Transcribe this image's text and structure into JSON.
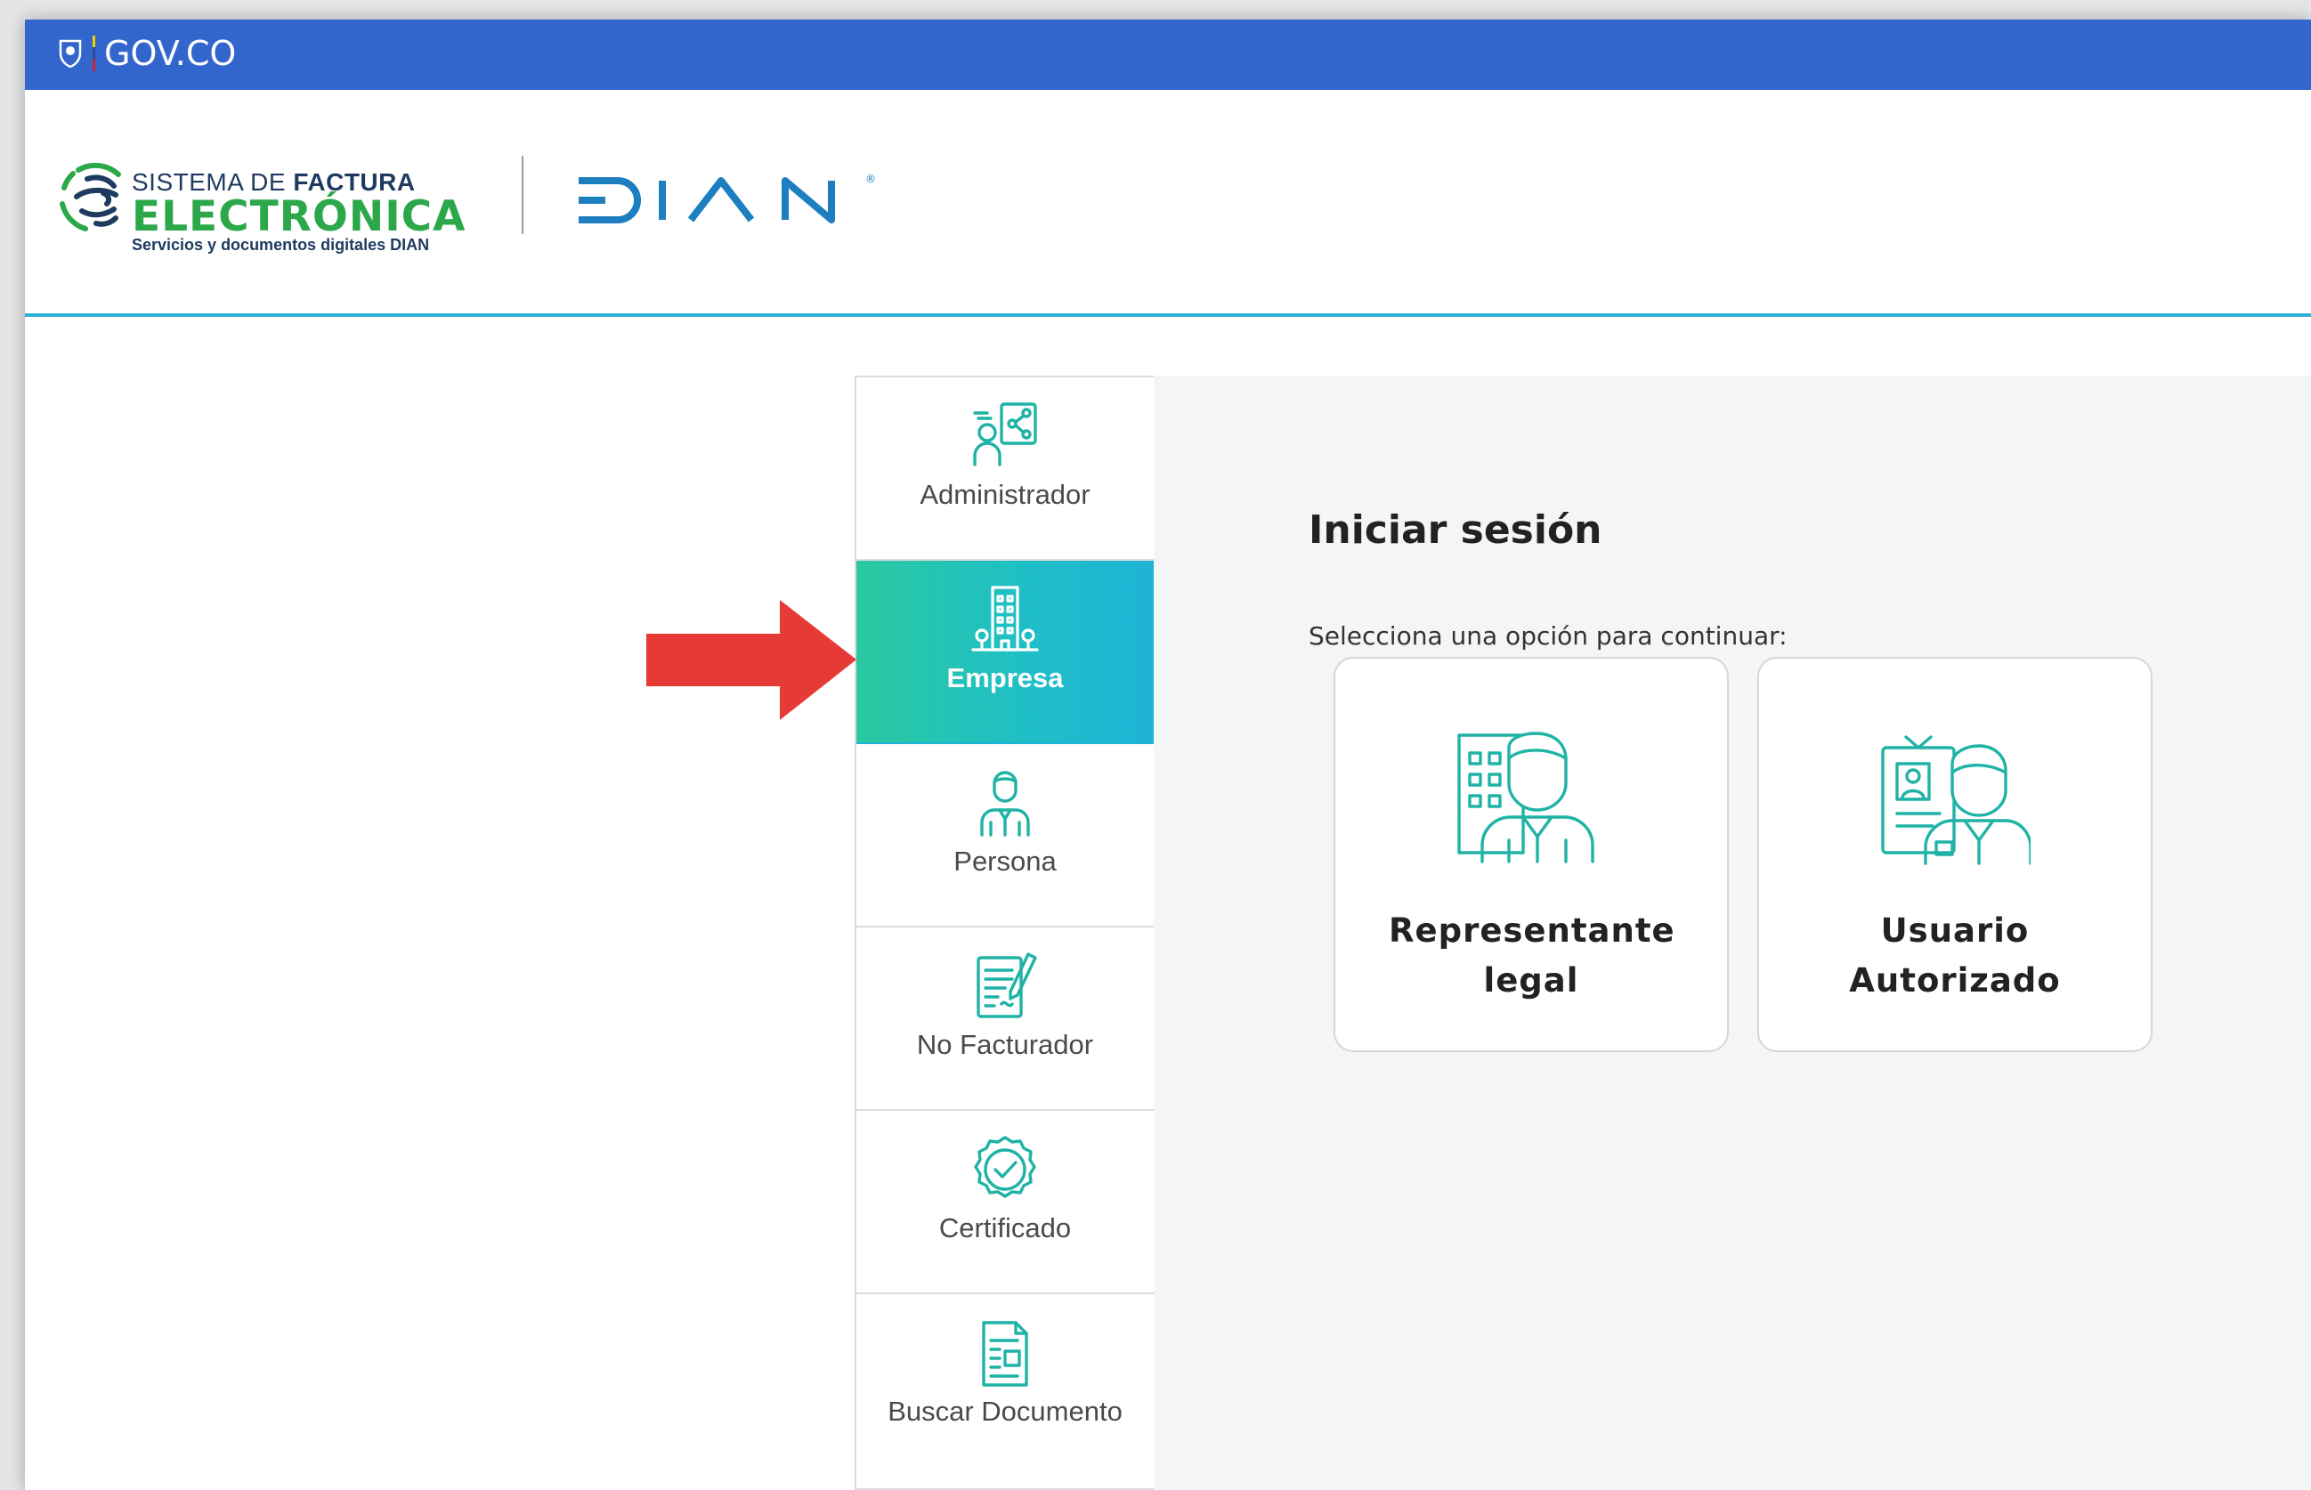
{
  "govbar": {
    "logo_text": "GOV.CO"
  },
  "brand": {
    "fe_line1_prefix": "SISTEMA DE ",
    "fe_line1_bold": "FACTURA",
    "fe_line2": "ELECTRÓNICA",
    "fe_line3": "Servicios y documentos digitales DIAN",
    "dian_logo": "DIAN"
  },
  "colors": {
    "gov_blue": "#3366cc",
    "accent_teal": "#1fb3d7",
    "accent_green": "#2bc9a0",
    "arrow_red": "#e53a35"
  },
  "tabs": [
    {
      "label": "Administrador",
      "icon": "admin-network-icon",
      "active": false
    },
    {
      "label": "Empresa",
      "icon": "building-icon",
      "active": true
    },
    {
      "label": "Persona",
      "icon": "person-icon",
      "active": false
    },
    {
      "label": "No Facturador",
      "icon": "document-pen-icon",
      "active": false
    },
    {
      "label": "Certificado",
      "icon": "certificate-badge-icon",
      "active": false
    },
    {
      "label": "Buscar Documento",
      "icon": "search-document-icon",
      "active": false
    }
  ],
  "login": {
    "title": "Iniciar sesión",
    "subtitle": "Selecciona una opción para continuar:",
    "options": [
      {
        "label": "Representante legal",
        "icon": "legal-representative-icon"
      },
      {
        "label": "Usuario Autorizado",
        "icon": "authorized-user-icon"
      }
    ]
  }
}
